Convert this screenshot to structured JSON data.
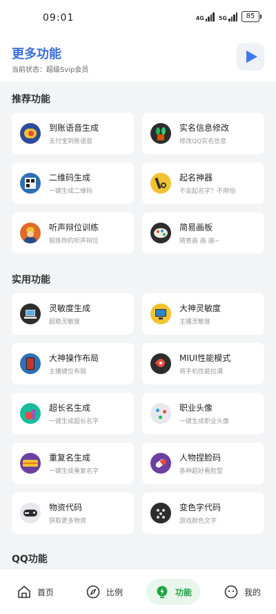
{
  "status_bar": {
    "time": "09:01",
    "network1": "4G",
    "network2": "5G",
    "battery": "85"
  },
  "header": {
    "title": "更多功能",
    "status": "当前状态：超级Svip会员"
  },
  "sections": {
    "recommended": {
      "title": "推荐功能",
      "items": [
        {
          "title": "到账语音生成",
          "subtitle": "支付宝到账语音",
          "icon": "money-icon"
        },
        {
          "title": "实名信息修改",
          "subtitle": "修改QQ实名信息",
          "icon": "plant-icon"
        },
        {
          "title": "二维码生成",
          "subtitle": "一键生成二维码",
          "icon": "qrcode-icon"
        },
        {
          "title": "起名神器",
          "subtitle": "不会起名字？不用怕",
          "icon": "name-icon"
        },
        {
          "title": "听声辩位训练",
          "subtitle": "锻炼你的听声辩位",
          "icon": "worker-icon"
        },
        {
          "title": "简易画板",
          "subtitle": "随意画 画 画~",
          "icon": "palette-icon"
        }
      ]
    },
    "practical": {
      "title": "实用功能",
      "items": [
        {
          "title": "灵敏度生成",
          "subtitle": "超稳灵敏度",
          "icon": "laptop-icon"
        },
        {
          "title": "大神灵敏度",
          "subtitle": "主播灵敏度",
          "icon": "monitor-icon"
        },
        {
          "title": "大神操作布局",
          "subtitle": "主播键位布局",
          "icon": "tablet-icon"
        },
        {
          "title": "MIUI性能模式",
          "subtitle": "将手机性能拉满",
          "icon": "rocket-icon"
        },
        {
          "title": "超长名生成",
          "subtitle": "一键生成超长名字",
          "icon": "flask-icon"
        },
        {
          "title": "职业头像",
          "subtitle": "一键生成职业头像",
          "icon": "network-icon"
        },
        {
          "title": "重复名生成",
          "subtitle": "一键生成重复名字",
          "icon": "tag-icon"
        },
        {
          "title": "人物捏脸码",
          "subtitle": "各种超好看脸型",
          "icon": "pill-icon"
        },
        {
          "title": "物资代码",
          "subtitle": "获取更多物资",
          "icon": "gamepad-icon"
        },
        {
          "title": "变色字代码",
          "subtitle": "游戏颜色文字",
          "icon": "dots-icon"
        }
      ]
    },
    "qq": {
      "title": "QQ功能"
    }
  },
  "tabs": [
    {
      "label": "首页",
      "icon": "home-icon"
    },
    {
      "label": "比例",
      "icon": "compass-icon"
    },
    {
      "label": "功能",
      "icon": "bulb-icon",
      "active": true
    },
    {
      "label": "我的",
      "icon": "profile-icon"
    }
  ],
  "colors": {
    "accent": "#3b6fd8",
    "active_tab": "#22a346",
    "active_tab_bg": "#e8f6ec"
  }
}
